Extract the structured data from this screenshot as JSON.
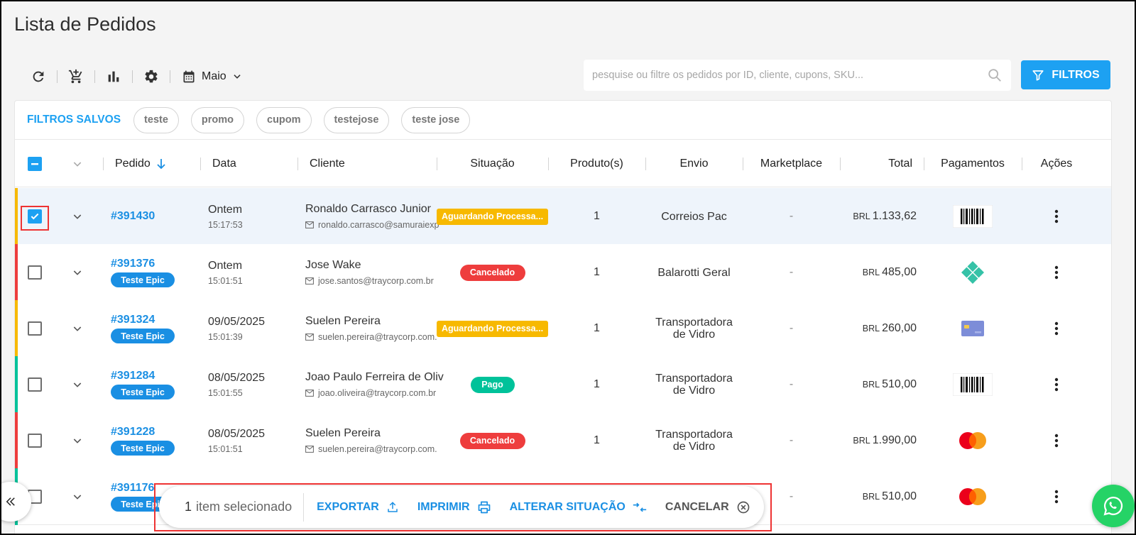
{
  "page": {
    "title": "Lista de Pedidos"
  },
  "toolbar": {
    "month_label": "Maio"
  },
  "search": {
    "placeholder": "pesquise ou filtre os pedidos por ID, cliente, cupons, SKU..."
  },
  "filters_button": {
    "label": "FILTROS"
  },
  "saved_filters": {
    "label": "FILTROS SALVOS",
    "chips": [
      "teste",
      "promo",
      "cupom",
      "testejose",
      "teste jose"
    ]
  },
  "table": {
    "headers": {
      "pedido": "Pedido",
      "data": "Data",
      "cliente": "Cliente",
      "situacao": "Situação",
      "produtos": "Produto(s)",
      "envio": "Envio",
      "marketplace": "Marketplace",
      "total": "Total",
      "pagamentos": "Pagamentos",
      "acoes": "Ações"
    },
    "rows": [
      {
        "id": "#391430",
        "tag": "",
        "date": "Ontem",
        "time": "15:17:53",
        "client": "Ronaldo Carrasco Junior",
        "email": "ronaldo.carrasco@samuraiexp",
        "status": "Aguardando Processa...",
        "status_kind": "aguard",
        "products": "1",
        "shipping_line1": "Correios Pac",
        "shipping_line2": "",
        "marketplace": "-",
        "currency": "BRL",
        "amount": "1.133,62",
        "payment_icon": "boleto-barcode-icon",
        "bar_color": "#f7b900",
        "selected": true
      },
      {
        "id": "#391376",
        "tag": "Teste Epic",
        "date": "Ontem",
        "time": "15:01:51",
        "client": "Jose Wake",
        "email": "jose.santos@traycorp.com.br",
        "status": "Cancelado",
        "status_kind": "canc",
        "products": "1",
        "shipping_line1": "Balarotti Geral",
        "shipping_line2": "",
        "marketplace": "-",
        "currency": "BRL",
        "amount": "485,00",
        "payment_icon": "pix-icon",
        "bar_color": "#ee3d3d",
        "selected": false
      },
      {
        "id": "#391324",
        "tag": "Teste Epic",
        "date": "09/05/2025",
        "time": "15:01:39",
        "client": "Suelen Pereira",
        "email": "suelen.pereira@traycorp.com.",
        "status": "Aguardando Processa...",
        "status_kind": "aguard",
        "products": "1",
        "shipping_line1": "Transportadora",
        "shipping_line2": "de Vidro",
        "marketplace": "-",
        "currency": "BRL",
        "amount": "260,00",
        "payment_icon": "credit-card-icon",
        "bar_color": "#f7b900",
        "selected": false
      },
      {
        "id": "#391284",
        "tag": "Teste Epic",
        "date": "08/05/2025",
        "time": "15:01:55",
        "client": "Joao Paulo Ferreira de Oliv",
        "email": "joao.oliveira@traycorp.com.br",
        "status": "Pago",
        "status_kind": "pago",
        "products": "1",
        "shipping_line1": "Transportadora",
        "shipping_line2": "de Vidro",
        "marketplace": "-",
        "currency": "BRL",
        "amount": "510,00",
        "payment_icon": "boleto-barcode-icon",
        "bar_color": "#00c29a",
        "selected": false
      },
      {
        "id": "#391228",
        "tag": "Teste Epic",
        "date": "08/05/2025",
        "time": "15:01:51",
        "client": "Suelen Pereira",
        "email": "suelen.pereira@traycorp.com.",
        "status": "Cancelado",
        "status_kind": "canc",
        "products": "1",
        "shipping_line1": "Transportadora",
        "shipping_line2": "de Vidro",
        "marketplace": "-",
        "currency": "BRL",
        "amount": "1.990,00",
        "payment_icon": "mastercard-icon",
        "bar_color": "#ee3d3d",
        "selected": false
      },
      {
        "id": "#391176",
        "tag": "Teste Epic",
        "date": "",
        "time": "",
        "client": "",
        "email": "",
        "status": "",
        "status_kind": "",
        "products": "",
        "shipping_line1": "",
        "shipping_line2": "",
        "marketplace": "-",
        "currency": "BRL",
        "amount": "510,00",
        "payment_icon": "mastercard-icon",
        "bar_color": "#00c29a",
        "selected": false
      }
    ]
  },
  "bulk_bar": {
    "count": "1",
    "count_label": "item selecionado",
    "export_label": "EXPORTAR",
    "print_label": "IMPRIMIR",
    "change_status_label": "ALTERAR SITUAÇÃO",
    "cancel_label": "CANCELAR"
  },
  "colors": {
    "accent": "#1da1f2",
    "link": "#1a8fe3",
    "warning": "#f7b900",
    "danger": "#ee3d3d",
    "success": "#00c29a",
    "whatsapp": "#25d366"
  }
}
